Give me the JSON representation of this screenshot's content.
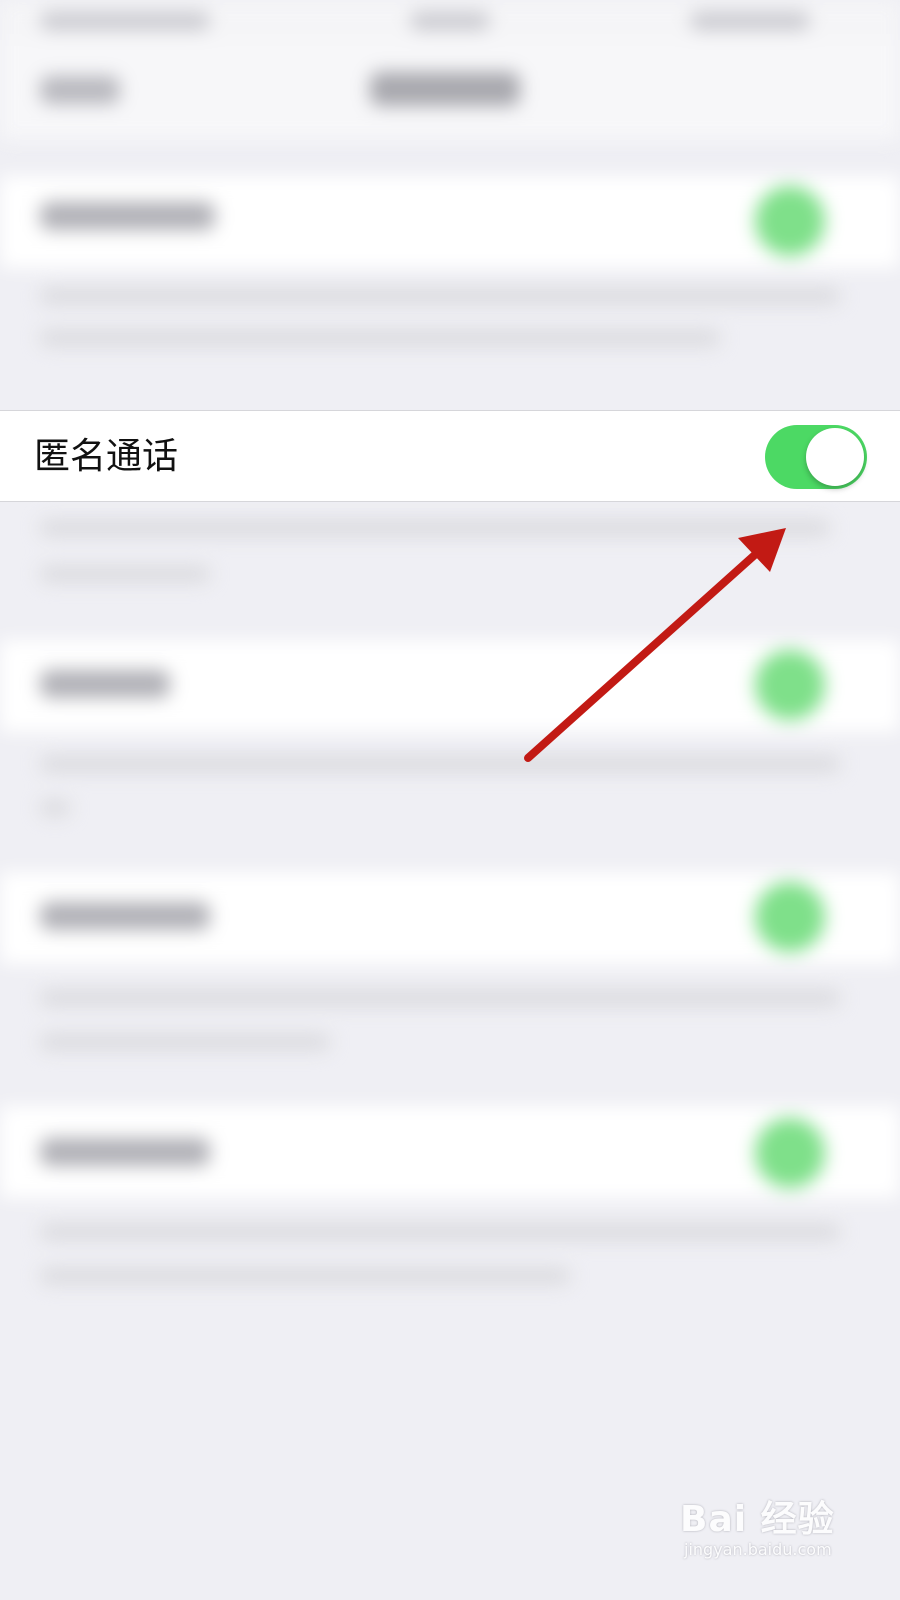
{
  "settings": {
    "anonymous_call": {
      "label": "匿名通话",
      "enabled": true
    }
  },
  "colors": {
    "toggle_on": "#4cd964",
    "arrow": "#c21a14",
    "background": "#efeff4"
  },
  "watermark": {
    "brand": "Bai 经验",
    "url": "jingyan.baidu.com"
  }
}
